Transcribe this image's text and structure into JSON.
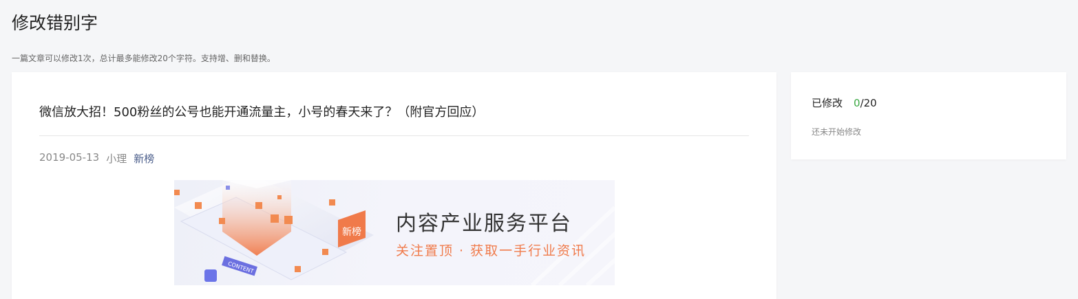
{
  "header": {
    "title": "修改错别字",
    "description": "一篇文章可以修改1次，总计最多能修改20个字符。支持增、删和替换。"
  },
  "article": {
    "title": "微信放大招！500粉丝的公号也能开通流量主，小号的春天来了？（附官方回应）",
    "date": "2019-05-13",
    "author": "小理",
    "source": "新榜",
    "banner": {
      "logo_text": "新榜",
      "tag_text": "CONTENT",
      "main_text": "内容产业服务平台",
      "sub_text": "关注置顶 · 获取一手行业资讯",
      "accent_color": "#f07a4a"
    }
  },
  "sidebar": {
    "status_label": "已修改",
    "modified_count": "0",
    "total": "/20",
    "note": "还未开始修改",
    "count_color": "#3aa843"
  }
}
